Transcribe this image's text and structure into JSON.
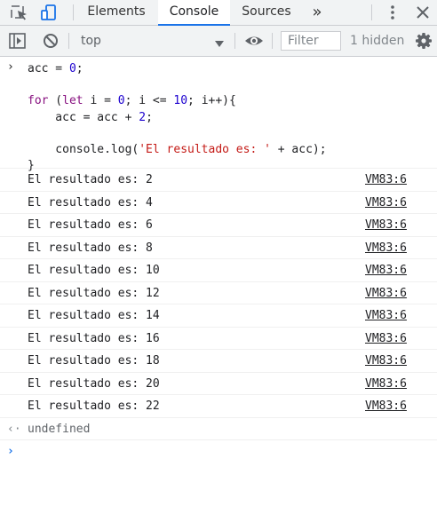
{
  "tabs": {
    "elements": "Elements",
    "console": "Console",
    "sources": "Sources",
    "more": "»"
  },
  "toolbar": {
    "context": "top",
    "filter_placeholder": "Filter",
    "hidden_count": "1 hidden"
  },
  "colors": {
    "accent": "#1a73e8",
    "keyword": "#881280",
    "number": "#1c00cf",
    "string": "#c41a16"
  },
  "icons": {
    "inspect": "cursor-select-icon",
    "device": "device-toolbar-icon",
    "more": "kebab-menu-icon",
    "close": "close-icon",
    "sidebar": "sidebar-toggle-icon",
    "clear": "clear-console-icon",
    "live": "eye-icon",
    "settings": "gear-icon"
  },
  "code": {
    "l1_a": "acc = ",
    "l1_b": "0",
    "l1_c": ";",
    "l2_kw1": "for",
    "l2_a": " (",
    "l2_kw2": "let",
    "l2_b": " i = ",
    "l2_n1": "0",
    "l2_c": "; i <= ",
    "l2_n2": "10",
    "l2_d": "; i++){",
    "l3_a": "    acc = acc + ",
    "l3_n": "2",
    "l3_b": ";",
    "l4_a": "    console.log(",
    "l4_s": "'El resultado es: '",
    "l4_b": " + acc);",
    "l5": "}"
  },
  "logs": [
    {
      "text": "El resultado es: 2",
      "source": "VM83:6"
    },
    {
      "text": "El resultado es: 4",
      "source": "VM83:6"
    },
    {
      "text": "El resultado es: 6",
      "source": "VM83:6"
    },
    {
      "text": "El resultado es: 8",
      "source": "VM83:6"
    },
    {
      "text": "El resultado es: 10",
      "source": "VM83:6"
    },
    {
      "text": "El resultado es: 12",
      "source": "VM83:6"
    },
    {
      "text": "El resultado es: 14",
      "source": "VM83:6"
    },
    {
      "text": "El resultado es: 16",
      "source": "VM83:6"
    },
    {
      "text": "El resultado es: 18",
      "source": "VM83:6"
    },
    {
      "text": "El resultado es: 20",
      "source": "VM83:6"
    },
    {
      "text": "El resultado es: 22",
      "source": "VM83:6"
    }
  ],
  "return_value": "undefined",
  "prompt_glyph": "›",
  "return_glyph": "‹·"
}
